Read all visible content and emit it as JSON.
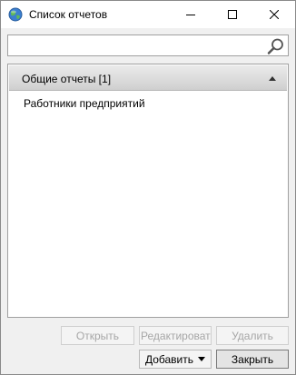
{
  "window": {
    "title": "Список отчетов"
  },
  "search": {
    "value": "",
    "placeholder": ""
  },
  "groups": [
    {
      "label": "Общие отчеты [1]",
      "items": [
        {
          "label": "Работники предприятий"
        }
      ]
    }
  ],
  "buttons": {
    "open": "Открыть",
    "edit": "Редактироват",
    "delete": "Удалить",
    "add": "Добавить",
    "close": "Закрыть"
  },
  "icons": {
    "app": "globe-icon",
    "minimize": "minimize-icon",
    "maximize": "maximize-icon",
    "close": "close-icon",
    "search": "search-icon",
    "collapse": "chevron-up-icon",
    "dropdown": "chevron-down-icon"
  }
}
